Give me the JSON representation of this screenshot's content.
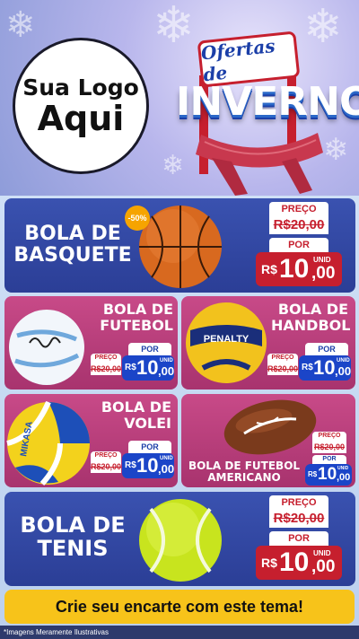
{
  "logo": {
    "line1": "Sua Logo",
    "line2": "Aqui"
  },
  "campaign": {
    "sign_text": "Ofertas de",
    "title": "INVERNO"
  },
  "products": [
    {
      "name_l1": "BOLA DE",
      "name_l2": "BASQUETE",
      "badge": "-50%",
      "price_label": "PREÇO",
      "old_price": "R$20,00",
      "por_label": "POR",
      "currency": "R$",
      "price_int": "10",
      "price_dec": ",00",
      "unit": "UNID"
    },
    {
      "name_l1": "BOLA DE",
      "name_l2": "FUTEBOL",
      "price_label": "PREÇO",
      "old_price": "R$20,00",
      "por_label": "POR",
      "currency": "R$",
      "price_int": "10",
      "price_dec": ",00",
      "unit": "UNID"
    },
    {
      "name_l1": "BOLA DE",
      "name_l2": "HANDBOL",
      "price_label": "PREÇO",
      "old_price": "R$20,00",
      "por_label": "POR",
      "currency": "R$",
      "price_int": "10",
      "price_dec": ",00",
      "unit": "UNID"
    },
    {
      "name_l1": "BOLA DE",
      "name_l2": "VOLEI",
      "price_label": "PREÇO",
      "old_price": "R$20,00",
      "por_label": "POR",
      "currency": "R$",
      "price_int": "10",
      "price_dec": ",00",
      "unit": "UNID"
    },
    {
      "name_l1": "BOLA DE FUTEBOL",
      "name_l2": "AMERICANO",
      "price_label": "PREÇO",
      "old_price": "R$20,00",
      "por_label": "POR",
      "currency": "R$",
      "price_int": "10",
      "price_dec": ",00",
      "unit": "UNID"
    },
    {
      "name_l1": "BOLA DE",
      "name_l2": "TENIS",
      "price_label": "PREÇO",
      "old_price": "R$20,00",
      "por_label": "POR",
      "currency": "R$",
      "price_int": "10",
      "price_dec": ",00",
      "unit": "UNID"
    }
  ],
  "ball_brands": {
    "futebol": "umbro",
    "handbol": "PENALTY",
    "volei": "MIKASA"
  },
  "cta": "Crie seu encarte com este tema!",
  "footer_note": "*Imagens Meramente Ilustrativas",
  "colors": {
    "blue_card": "#2b3e96",
    "pink_card": "#a8336e",
    "price_blue": "#1b45c8",
    "price_red": "#c61f2e",
    "cta": "#f7c31a"
  }
}
